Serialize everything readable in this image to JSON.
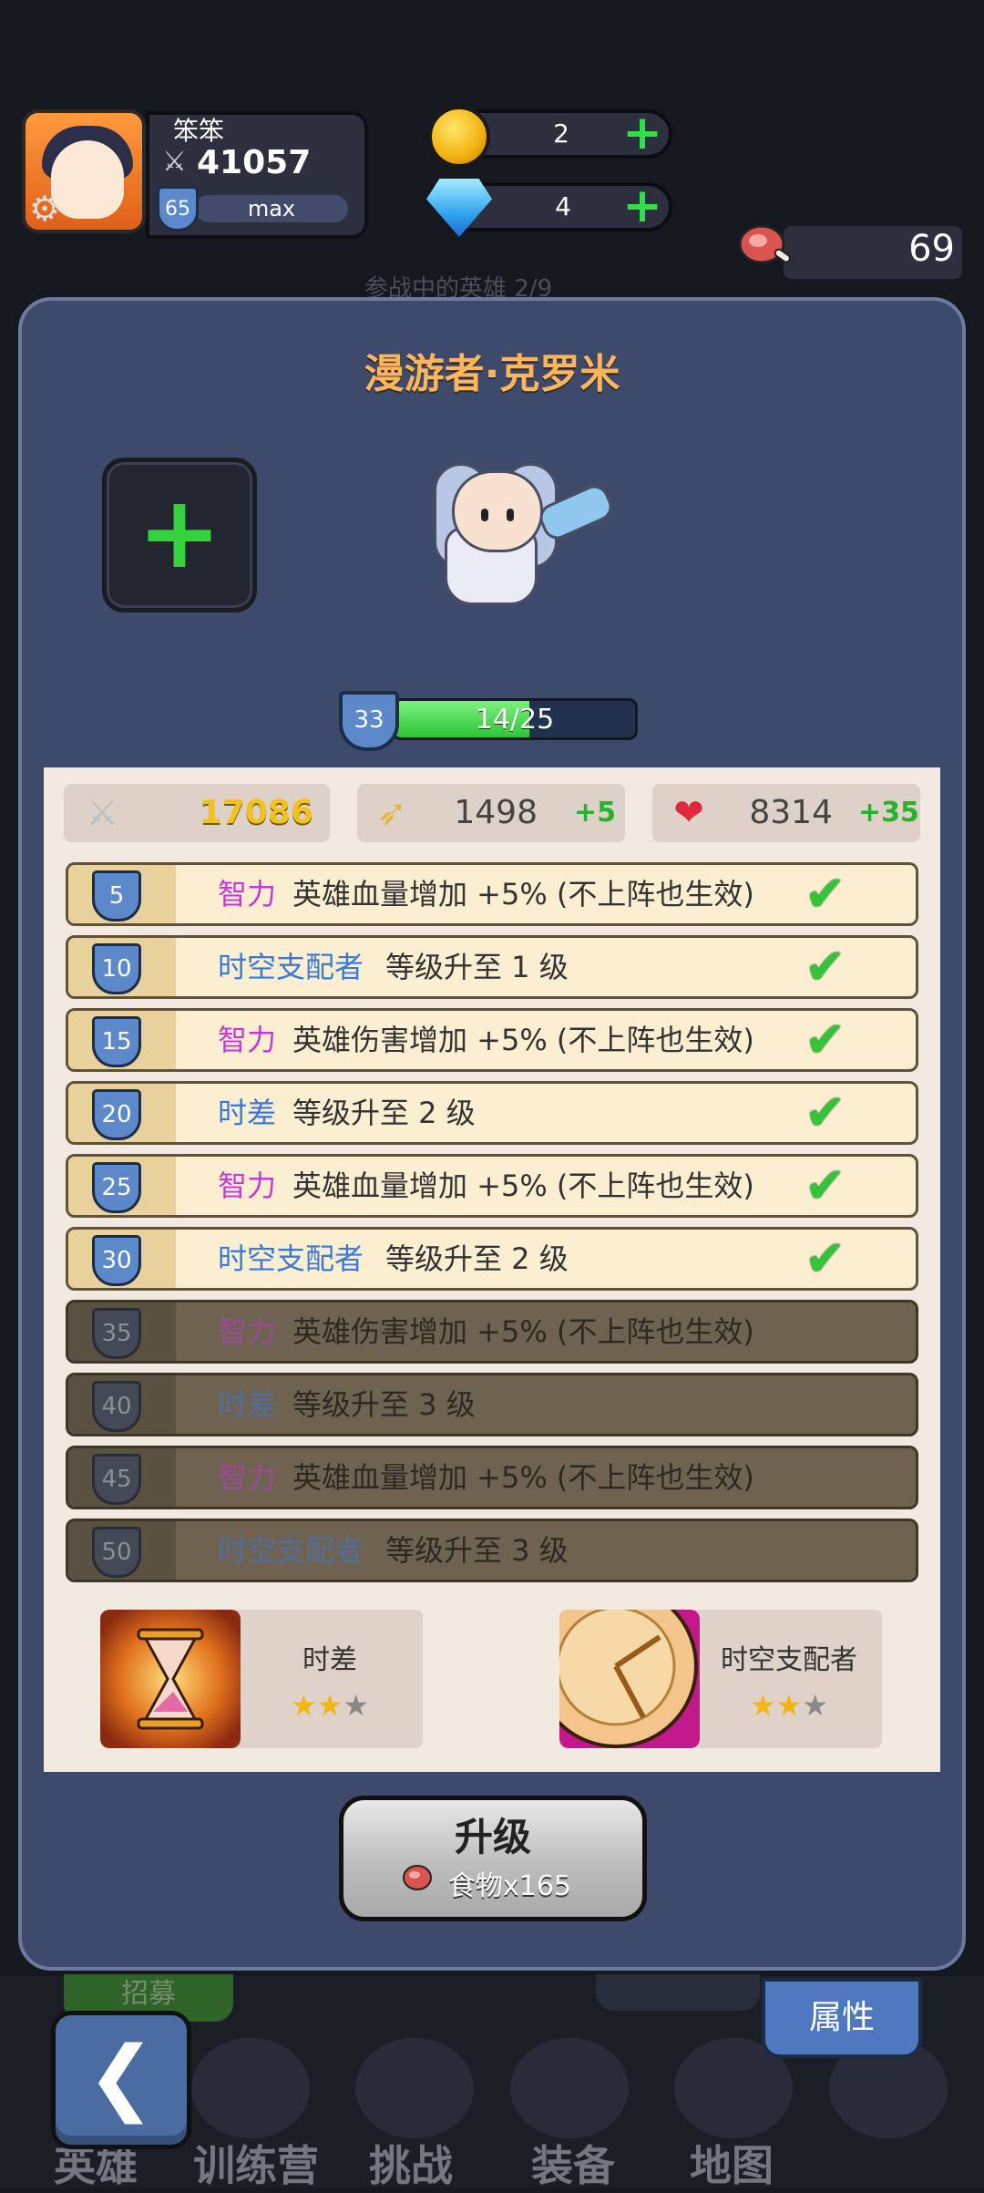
{
  "player": {
    "name": "笨笨",
    "power": "41057",
    "level": "65",
    "level_status": "max"
  },
  "resources": {
    "gold": "2",
    "diamond": "4",
    "meat": "69"
  },
  "faded_header": "参战中的英雄     2/9",
  "hero": {
    "name": "漫游者·克罗米",
    "level": "33",
    "xp_text": "14/25",
    "xp_ratio": 0.56
  },
  "stats": {
    "attack": "17086",
    "speed": "1498",
    "speed_bonus": "+5",
    "hp": "8314",
    "hp_bonus": "+35"
  },
  "talents": [
    {
      "level": "5",
      "keyword": "智力",
      "keyword_color": "#c33bd0",
      "desc": "英雄血量增加 +5% (不上阵也生效)",
      "unlocked": true
    },
    {
      "level": "10",
      "keyword": "时空支配者",
      "keyword_color": "#3b79d8",
      "desc": "等级升至 1 级",
      "unlocked": true
    },
    {
      "level": "15",
      "keyword": "智力",
      "keyword_color": "#c33bd0",
      "desc": "英雄伤害增加 +5% (不上阵也生效)",
      "unlocked": true
    },
    {
      "level": "20",
      "keyword": "时差",
      "keyword_color": "#3b79d8",
      "desc": "等级升至 2 级",
      "unlocked": true
    },
    {
      "level": "25",
      "keyword": "智力",
      "keyword_color": "#c33bd0",
      "desc": "英雄血量增加 +5% (不上阵也生效)",
      "unlocked": true
    },
    {
      "level": "30",
      "keyword": "时空支配者",
      "keyword_color": "#3b79d8",
      "desc": "等级升至 2 级",
      "unlocked": true
    },
    {
      "level": "35",
      "keyword": "智力",
      "keyword_color": "#c33bd0",
      "desc": "英雄伤害增加 +5% (不上阵也生效)",
      "unlocked": false
    },
    {
      "level": "40",
      "keyword": "时差",
      "keyword_color": "#3b79d8",
      "desc": "等级升至 3 级",
      "unlocked": false
    },
    {
      "level": "45",
      "keyword": "智力",
      "keyword_color": "#c33bd0",
      "desc": "英雄血量增加 +5% (不上阵也生效)",
      "unlocked": false
    },
    {
      "level": "50",
      "keyword": "时空支配者",
      "keyword_color": "#3b79d8",
      "desc": "等级升至 3 级",
      "unlocked": false
    }
  ],
  "skills": [
    {
      "name": "时差",
      "stars": 2,
      "max_stars": 3,
      "icon": "hourglass-icon"
    },
    {
      "name": "时空支配者",
      "stars": 2,
      "max_stars": 3,
      "icon": "clock-dial-icon"
    }
  ],
  "upgrade": {
    "label": "升级",
    "cost": "食物x165"
  },
  "nav": {
    "attribute_button": "属性",
    "partial_button": "招募",
    "items": [
      "英雄",
      "训练营",
      "挑战",
      "装备",
      "地图"
    ]
  },
  "colors": {
    "panel": "#3e4a6b",
    "card": "#f2e9e1",
    "gold_text": "#f2c218",
    "green_bonus": "#28b12c",
    "accent_orange": "#ffb55c"
  }
}
